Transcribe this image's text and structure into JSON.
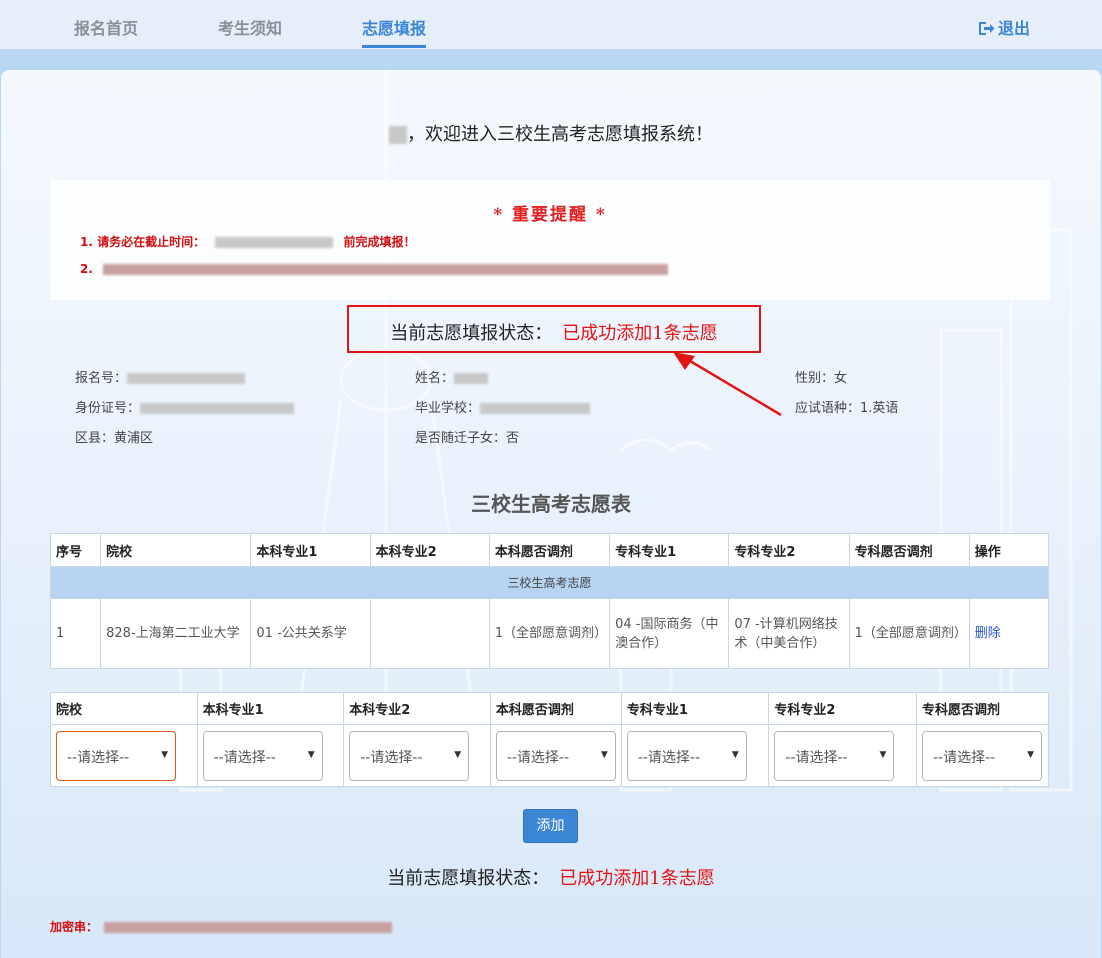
{
  "nav": {
    "tabs": [
      {
        "label": "报名首页"
      },
      {
        "label": "考生须知"
      },
      {
        "label": "志愿填报"
      }
    ],
    "active_tab": "志愿填报",
    "logout_label": "退出"
  },
  "welcome": {
    "text": "，欢迎进入三校生高考志愿填报系统！"
  },
  "notice": {
    "title": "* 重要提醒 *",
    "line1_prefix": "1. 请务必在截止时间：",
    "line1_suffix": "前完成填报！",
    "line2_prefix": "2."
  },
  "status": {
    "label": "当前志愿填报状态：",
    "value": "已成功添加1条志愿"
  },
  "student": {
    "reg_no_label": "报名号：",
    "name_label": "姓名：",
    "gender_label": "性别：",
    "gender": "女",
    "id_label": "身份证号：",
    "school_label": "毕业学校：",
    "language_label": "应试语种：",
    "language": "1.英语",
    "district_label": "区县：",
    "district": "黄浦区",
    "migrant_label": "是否随迁子女：",
    "migrant": "否"
  },
  "table": {
    "title": "三校生高考志愿表",
    "headers": [
      "序号",
      "院校",
      "本科专业1",
      "本科专业2",
      "本科愿否调剂",
      "专科专业1",
      "专科专业2",
      "专科愿否调剂",
      "操作"
    ],
    "group_label": "三校生高考志愿",
    "rows": [
      {
        "index": "1",
        "school": "828-上海第二工业大学",
        "bachelor1": "01 -公共关系学",
        "bachelor2": "",
        "bachelor_adjust": "1（全部愿意调剂）",
        "college1": "04 -国际商务（中澳合作）",
        "college2": "07 -计算机网络技术（中美合作）",
        "college_adjust": "1（全部愿意调剂）",
        "action": "删除"
      }
    ]
  },
  "form": {
    "headers": [
      "院校",
      "本科专业1",
      "本科专业2",
      "本科愿否调剂",
      "专科专业1",
      "专科专业2",
      "专科愿否调剂"
    ],
    "placeholder": "--请选择--",
    "add_label": "添加"
  },
  "cipher": {
    "label": "加密串："
  },
  "colors": {
    "accent": "#3c86d6",
    "alert": "#e41414"
  }
}
